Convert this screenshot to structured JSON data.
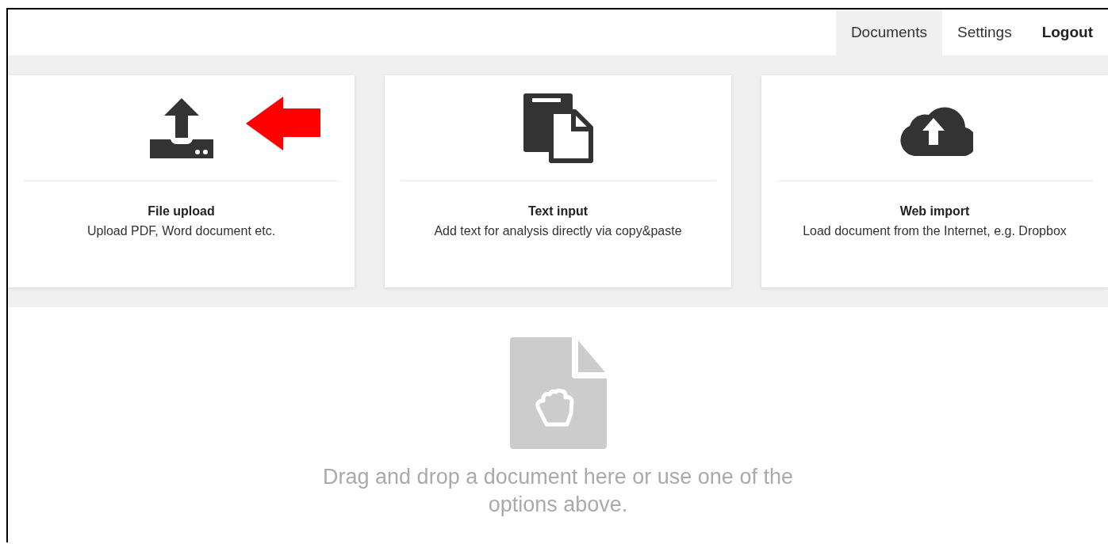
{
  "nav": [
    {
      "label": "Documents",
      "kind": "link",
      "selected": true
    },
    {
      "label": "Settings",
      "kind": "link",
      "selected": false
    },
    {
      "label": "Logout",
      "kind": "action",
      "selected": false
    }
  ],
  "cards": [
    {
      "kind": "upload",
      "title": "File upload",
      "description": "Upload PDF, Word document etc.",
      "highlighted": true
    },
    {
      "kind": "text",
      "title": "Text input",
      "description": "Add text for analysis directly via copy&paste",
      "highlighted": false
    },
    {
      "kind": "cloud",
      "title": "Web import",
      "description": "Load document from the Internet, e.g. Dropbox",
      "highlighted": false
    }
  ],
  "dropzone": {
    "message": "Drag and drop a document here or use one of the options above."
  }
}
